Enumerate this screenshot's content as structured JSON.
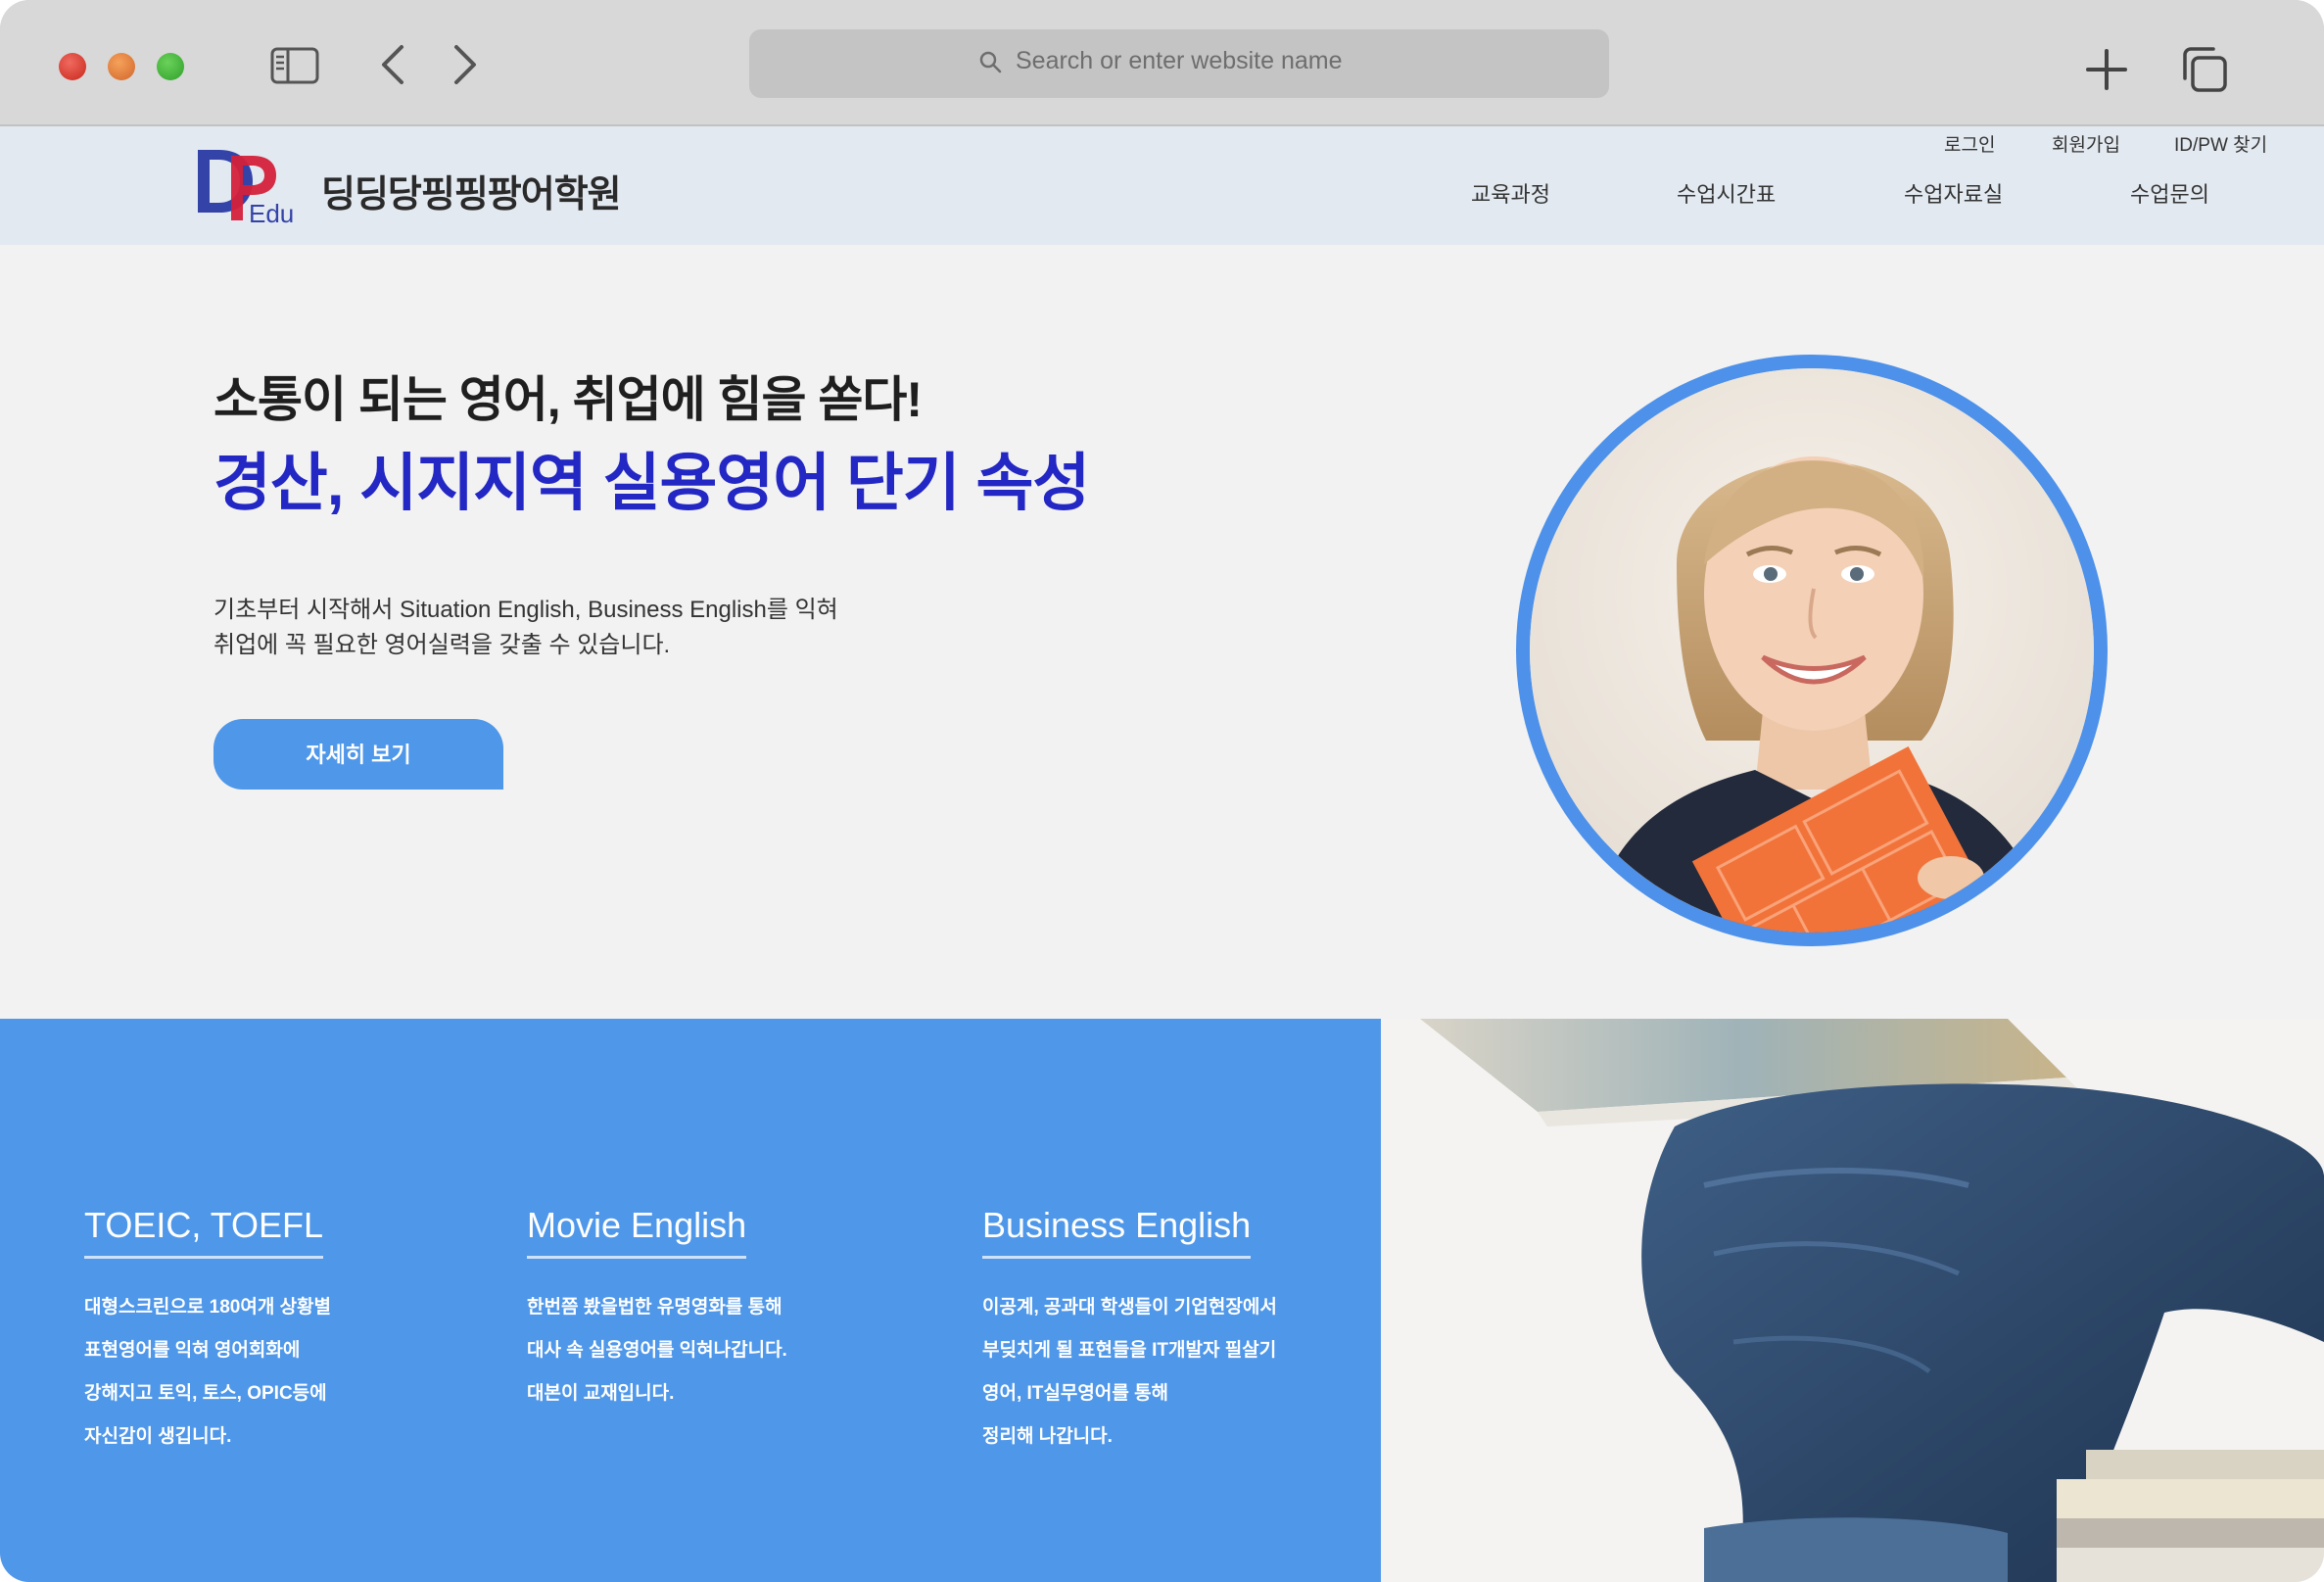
{
  "browser": {
    "url_placeholder": "Search or enter website name",
    "traffic_lights": {
      "close": "#d9362b",
      "minimize": "#e07a33",
      "zoom": "#3fb23a"
    },
    "icons": [
      "sidebar-icon",
      "back-chevron-icon",
      "forward-chevron-icon",
      "search-icon",
      "plus-icon",
      "tabs-overview-icon"
    ]
  },
  "header": {
    "logo": {
      "letters": "DP",
      "sub": "Edu"
    },
    "site_name": "딩딩당핑핑팡어학원",
    "util_links": [
      "로그인",
      "회원가입",
      "ID/PW 찾기"
    ],
    "nav": [
      "교육과정",
      "수업시간표",
      "수업자료실",
      "수업문의"
    ]
  },
  "hero": {
    "heading": "소통이 되는 영어, 취업에 힘을 쏟다!",
    "subheading": "경산, 시지지역 실용영어 단기 속성",
    "description": [
      "기초부터 시작해서 Situation English, Business English를 익혀",
      "취업에 꼭 필요한 영어실력을 갖출 수 있습니다."
    ],
    "button": "자세히 보기"
  },
  "courses": [
    {
      "title": "TOEIC, TOEFL",
      "lines": [
        "대형스크린으로 180여개 상황별",
        "표현영어를 익혀 영어회화에",
        "강해지고 토익, 토스, OPIC등에",
        "자신감이 생깁니다."
      ]
    },
    {
      "title": "Movie English",
      "lines": [
        "한번쯤 봤을법한 유명영화를 통해",
        "대사 속 실용영어를 익혀나갑니다.",
        "대본이 교재입니다."
      ]
    },
    {
      "title": "Business English",
      "lines": [
        "이공계, 공과대 학생들이 기업현장에서",
        "부딪치게 될 표현들을 IT개발자 필살기",
        "영어, IT실무영어를 통해",
        "정리해 나갑니다."
      ]
    }
  ],
  "colors": {
    "accent_blue": "#4f97e9",
    "headline_blue": "#2327c4",
    "header_bg": "#e3e9f1",
    "logo_blue": "#3343a8",
    "logo_red": "#d4213a"
  }
}
